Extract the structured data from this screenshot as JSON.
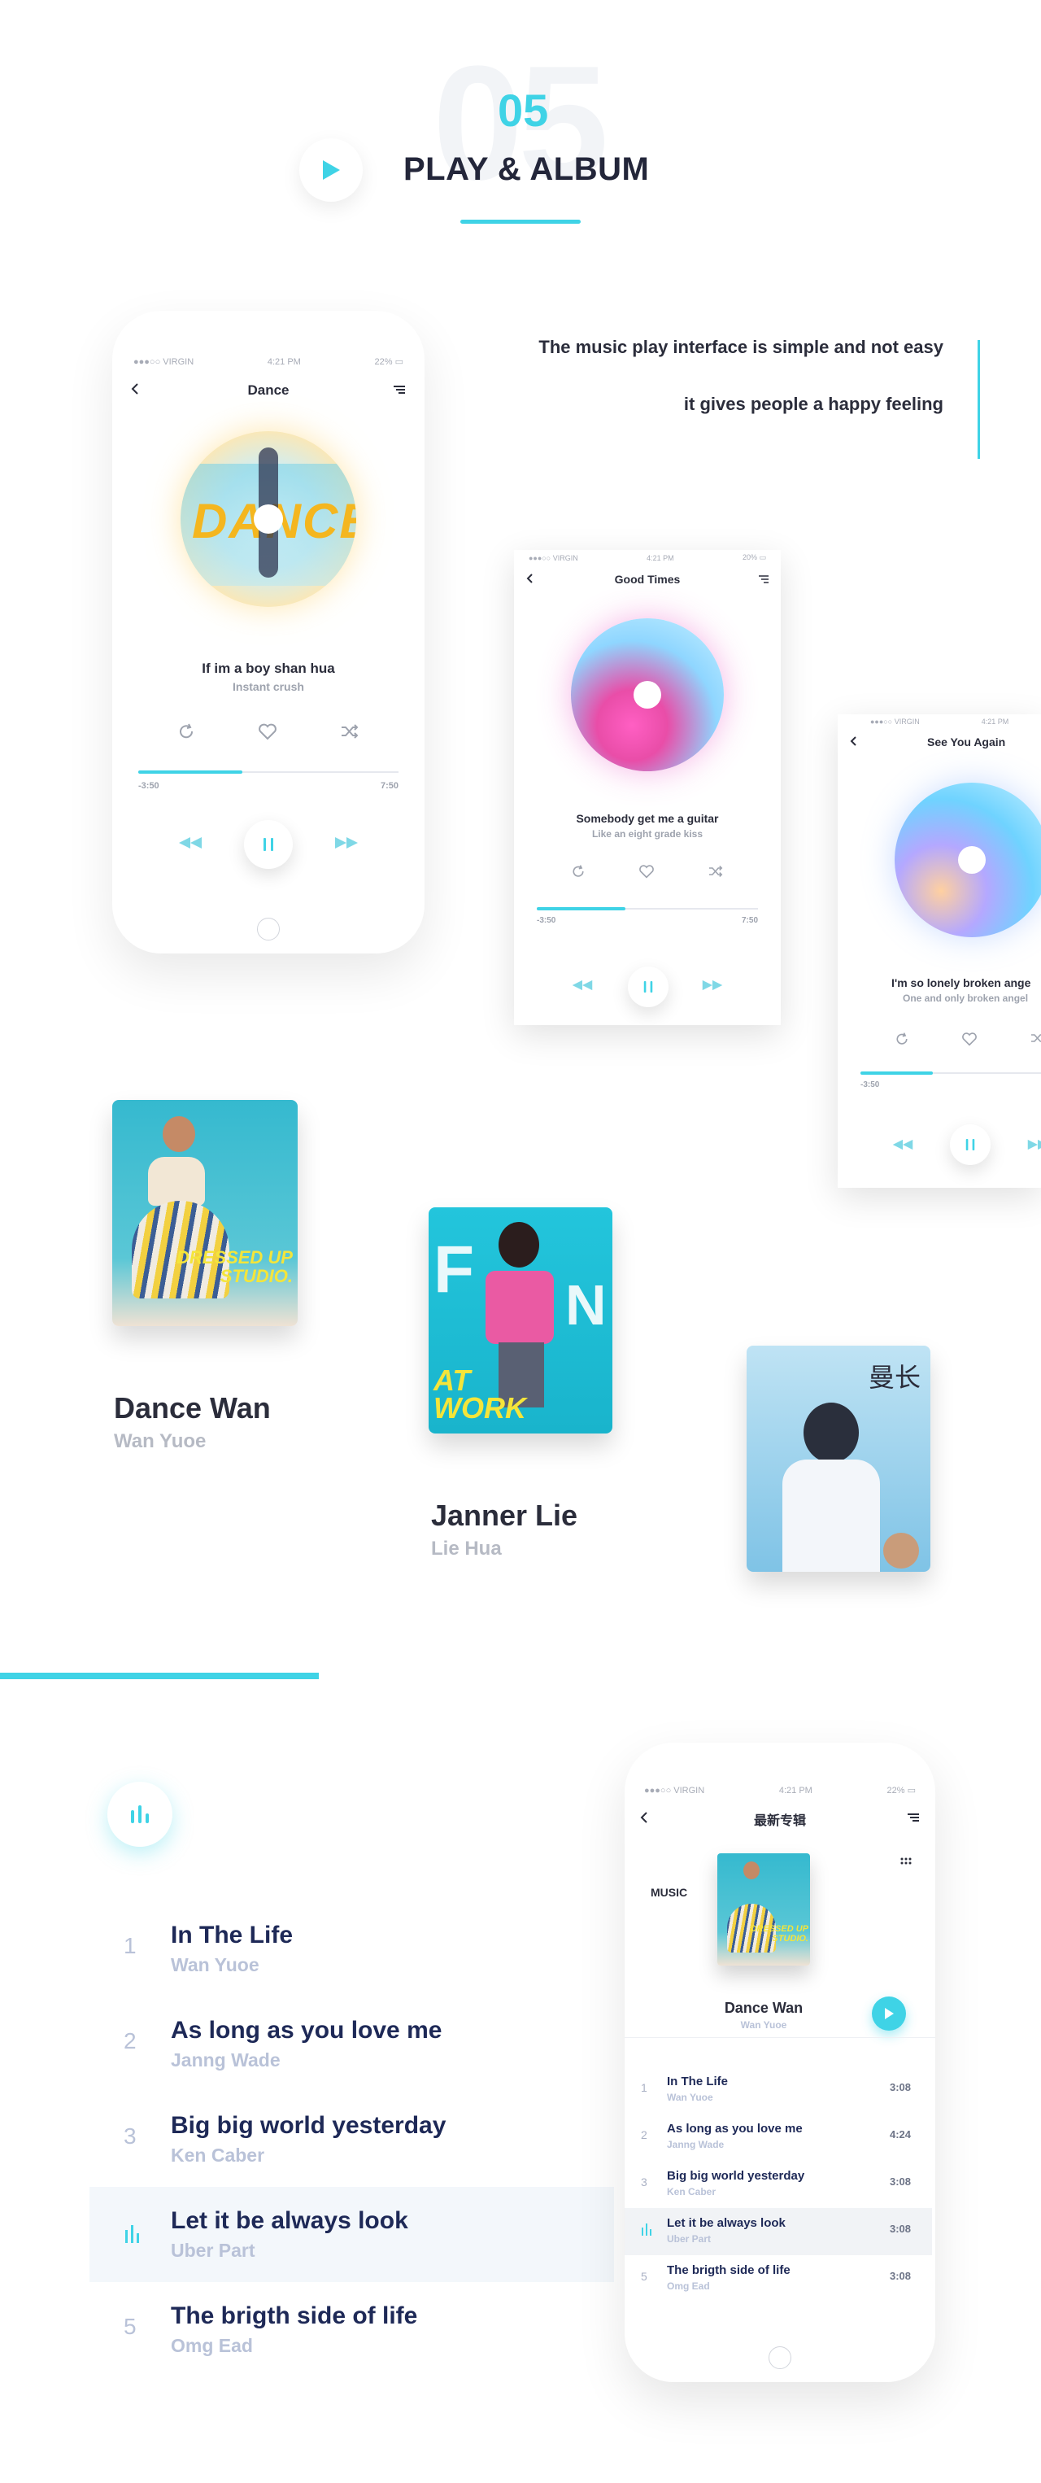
{
  "header": {
    "big_number": "05",
    "number": "05",
    "title": "PLAY & ALBUM"
  },
  "intro": {
    "line1": "The music play interface is simple and not easy",
    "line2": "it gives people a happy feeling"
  },
  "colors": {
    "accent": "#3fd3e6",
    "title": "#23263a",
    "list_title": "#1e2957",
    "muted": "#b9c2d8"
  },
  "status": {
    "carrier": "VIRGIN",
    "time": "4:21 PM",
    "battery": "22%",
    "battery2": "20%"
  },
  "player1": {
    "title": "Dance",
    "song": "If im a boy shan hua",
    "artist": "Instant crush",
    "elapsed": "-3:50",
    "total": "7:50",
    "progress": 0.4,
    "disc_word": "DANCE"
  },
  "player2": {
    "title": "Good Times",
    "song": "Somebody get me a guitar",
    "artist": "Like an eight grade kiss",
    "elapsed": "-3:50",
    "total": "7:50",
    "progress": 0.4
  },
  "player3": {
    "title": "See You Again",
    "song": "I'm so lonely broken ange",
    "artist": "One and only broken angel",
    "elapsed": "-3:50",
    "progress": 0.4
  },
  "albums": [
    {
      "name": "Dance Wan",
      "artist": "Wan Yuoe",
      "cover_text": "DRESSED UP STUDIO."
    },
    {
      "name": "Janner Lie",
      "artist": "Lie Hua",
      "cover_text": "AT WORK"
    },
    {
      "cover_text": "曼长"
    }
  ],
  "list": [
    {
      "num": "1",
      "title": "In The Life",
      "artist": "Wan Yuoe"
    },
    {
      "num": "2",
      "title": "As long as you love me",
      "artist": "Janng Wade"
    },
    {
      "num": "3",
      "title": "Big big world yesterday",
      "artist": "Ken Caber"
    },
    {
      "num": "4",
      "title": "Let it be always look",
      "artist": "Uber Part"
    },
    {
      "num": "5",
      "title": "The brigth side of life",
      "artist": "Omg Ead"
    }
  ],
  "album_phone": {
    "title": "最新专辑",
    "music_label": "MUSIC",
    "album_name": "Dance Wan",
    "album_artist": "Wan Yuoe",
    "cover_text": "DRESSED UP STUDIO.",
    "tracks": [
      {
        "num": "1",
        "title": "In The Life",
        "artist": "Wan Yuoe",
        "duration": "3:08"
      },
      {
        "num": "2",
        "title": "As long as you love me",
        "artist": "Janng Wade",
        "duration": "4:24"
      },
      {
        "num": "3",
        "title": "Big big world yesterday",
        "artist": "Ken Caber",
        "duration": "3:08"
      },
      {
        "num": "4",
        "title": "Let it be always look",
        "artist": "Uber Part",
        "duration": "3:08"
      },
      {
        "num": "5",
        "title": "The brigth side of life",
        "artist": "Omg Ead",
        "duration": "3:08"
      }
    ]
  }
}
